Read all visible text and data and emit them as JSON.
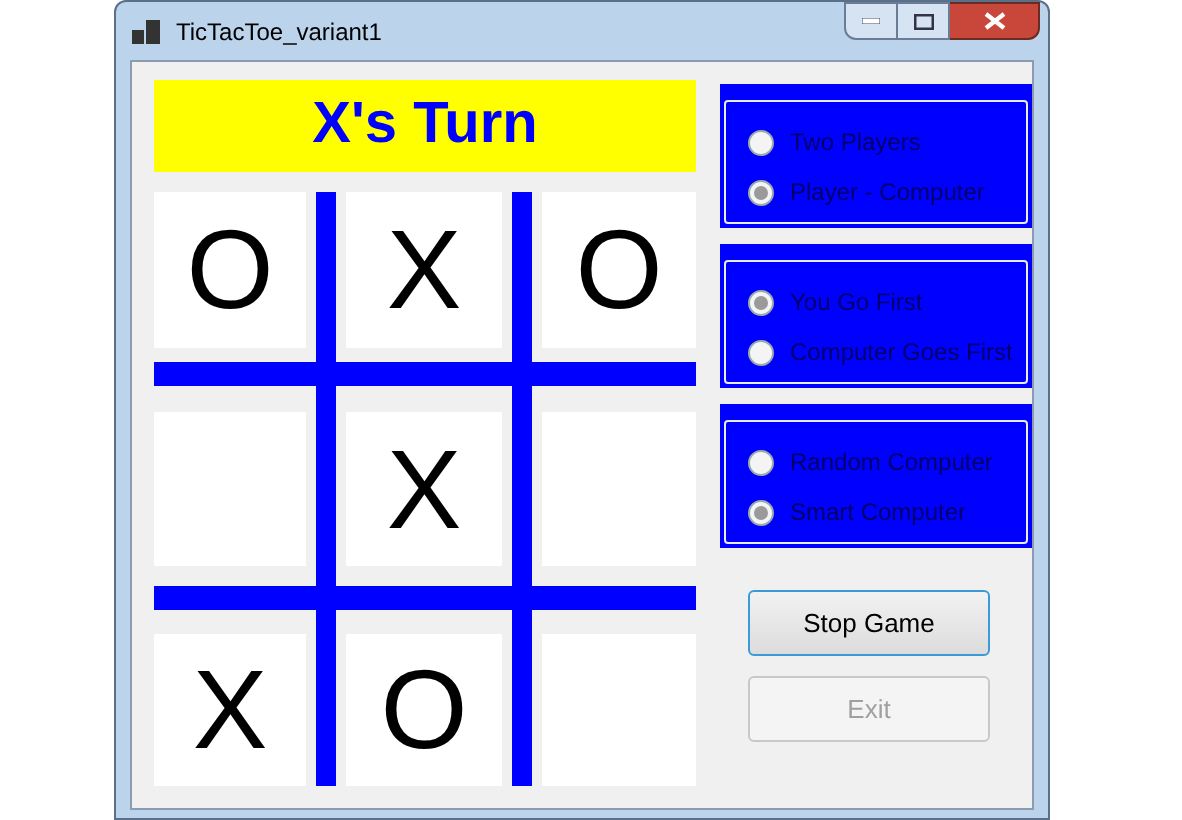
{
  "window": {
    "title": "TicTacToe_variant1"
  },
  "turn_label": "X's Turn",
  "board": [
    {
      "kind": "mark",
      "mark": "O"
    },
    {
      "kind": "mark",
      "mark": "X"
    },
    {
      "kind": "mark",
      "mark": "O"
    },
    {
      "kind": "blank"
    },
    {
      "kind": "mark",
      "mark": "X"
    },
    {
      "kind": "blank"
    },
    {
      "kind": "mark",
      "mark": "X"
    },
    {
      "kind": "mark",
      "mark": "O"
    },
    {
      "kind": "blank"
    }
  ],
  "option_groups": [
    {
      "options": [
        {
          "label": "Two Players",
          "selected": false
        },
        {
          "label": "Player - Computer",
          "selected": true
        }
      ]
    },
    {
      "options": [
        {
          "label": "You Go First",
          "selected": true
        },
        {
          "label": "Computer Goes First",
          "selected": false
        }
      ]
    },
    {
      "options": [
        {
          "label": "Random Computer",
          "selected": false
        },
        {
          "label": "Smart Computer",
          "selected": true
        }
      ]
    }
  ],
  "buttons": [
    {
      "label": "Stop Game",
      "disabled": false,
      "focused": true
    },
    {
      "label": "Exit",
      "disabled": true,
      "focused": false
    }
  ]
}
